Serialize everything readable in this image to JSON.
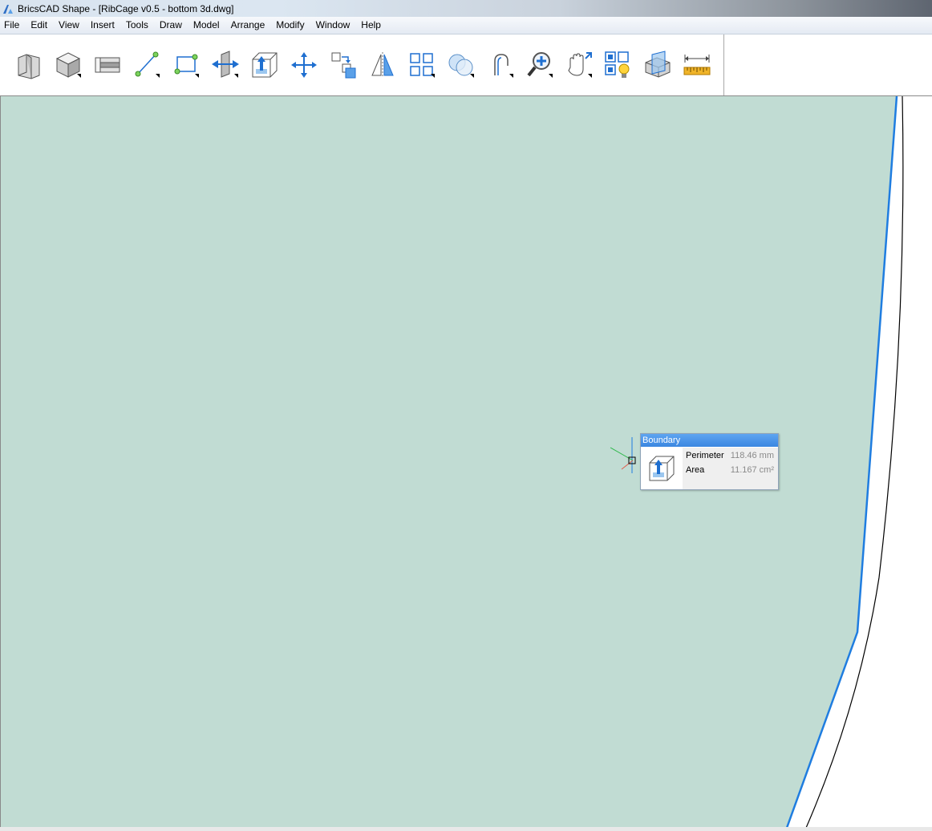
{
  "window": {
    "title": "BricsCAD Shape - [RibCage v0.5 - bottom 3d.dwg]"
  },
  "menu": {
    "items": [
      "File",
      "Edit",
      "View",
      "Insert",
      "Tools",
      "Draw",
      "Model",
      "Arrange",
      "Modify",
      "Window",
      "Help"
    ]
  },
  "toolbar": {
    "tools": [
      "wall-icon",
      "solid-box-icon",
      "slab-icon",
      "line-icon",
      "rectangle-icon",
      "push-pull-face-icon",
      "extrude-box-icon",
      "move-icon",
      "copy-icon",
      "mirror-icon",
      "array-icon",
      "boolean-icon",
      "fillet-icon",
      "zoom-icon",
      "pan-icon",
      "materials-lights-icon",
      "section-icon",
      "measure-ruler-icon"
    ]
  },
  "tooltip": {
    "title": "Boundary",
    "perimeter_label": "Perimeter",
    "perimeter_value": "118.46 mm",
    "area_label": "Area",
    "area_value": "11.167 cm²"
  },
  "colors": {
    "fill": "#c1dcd3",
    "highlight_edge": "#1f7de0",
    "curve": "#000000"
  }
}
